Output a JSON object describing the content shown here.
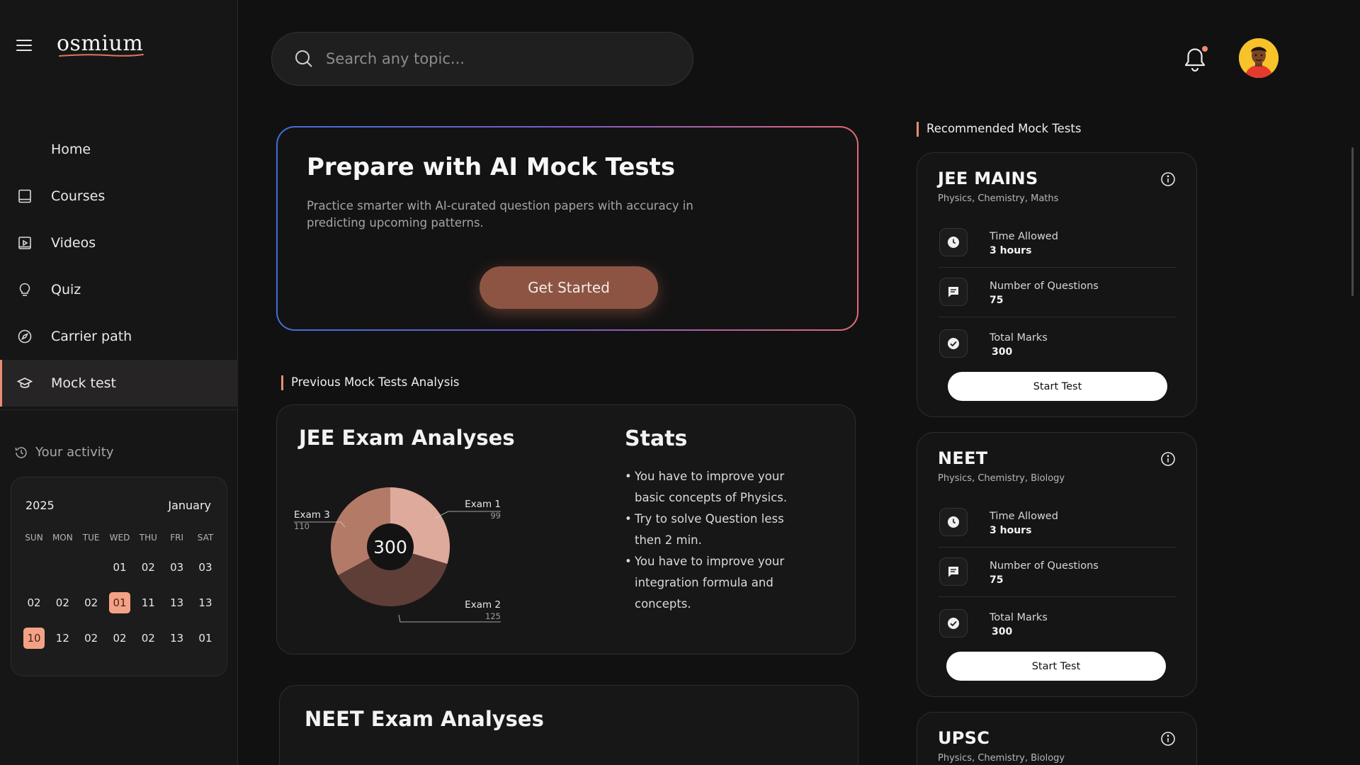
{
  "app": {
    "logo": "osmium"
  },
  "sidebar": {
    "items": [
      {
        "label": "Home",
        "icon": "home-icon",
        "active": false
      },
      {
        "label": "Courses",
        "icon": "book-icon",
        "active": false
      },
      {
        "label": "Videos",
        "icon": "video-icon",
        "active": false
      },
      {
        "label": "Quiz",
        "icon": "lightbulb-icon",
        "active": false
      },
      {
        "label": "Carrier path",
        "icon": "compass-icon",
        "active": false
      },
      {
        "label": "Mock test",
        "icon": "graduation-cap-icon",
        "active": true
      }
    ],
    "activity_label": "Your activity",
    "calendar": {
      "year": "2025",
      "month": "January",
      "weekdays": [
        "SUN",
        "MON",
        "TUE",
        "WED",
        "THU",
        "FRI",
        "SAT"
      ],
      "rows": [
        [
          "",
          "",
          "",
          "01",
          "02",
          "03",
          "03"
        ],
        [
          "02",
          "02",
          "02",
          "01",
          "11",
          "13",
          "13"
        ],
        [
          "10",
          "12",
          "02",
          "02",
          "02",
          "13",
          "01"
        ]
      ],
      "highlighted": [
        "1-3",
        "2-0"
      ]
    }
  },
  "header": {
    "search_placeholder": "Search any topic...",
    "notification_dot": true
  },
  "hero": {
    "title": "Prepare with AI Mock Tests",
    "description": "Practice smarter with AI-curated question papers with accuracy in predicting upcoming patterns.",
    "button": "Get Started"
  },
  "previous_section_title": "Previous Mock Tests Analysis",
  "analysis": {
    "title": "JEE Exam Analyses",
    "stats_title": "Stats",
    "stats": [
      "You have to improve your basic concepts of Physics.",
      "Try to solve Question less then 2 min.",
      "You have to improve your integration formula and concepts."
    ]
  },
  "chart_data": {
    "type": "pie",
    "center_label": "300",
    "slices": [
      {
        "label": "Exam 1",
        "value": 99,
        "color": "#deaa9b"
      },
      {
        "label": "Exam 2",
        "value": 125,
        "color": "#5e3e37"
      },
      {
        "label": "Exam 3",
        "value": 110,
        "color": "#b47a68"
      }
    ]
  },
  "analysis2": {
    "title": "NEET Exam Analyses"
  },
  "recommended": {
    "title": "Recommended Mock Tests",
    "cards": [
      {
        "title": "JEE MAINS",
        "subjects": "Physics, Chemistry, Maths",
        "time_label": "Time Allowed",
        "time_value": "3 hours",
        "questions_label": "Number of Questions",
        "questions_value": "75",
        "marks_label": "Total Marks",
        "marks_value": "300",
        "button": "Start Test"
      },
      {
        "title": "NEET",
        "subjects": "Physics, Chemistry, Biology",
        "time_label": "Time Allowed",
        "time_value": "3 hours",
        "questions_label": "Number of Questions",
        "questions_value": "75",
        "marks_label": "Total Marks",
        "marks_value": "300",
        "button": "Start Test"
      },
      {
        "title": "UPSC",
        "subjects": "Physics, Chemistry, Biology"
      }
    ]
  }
}
